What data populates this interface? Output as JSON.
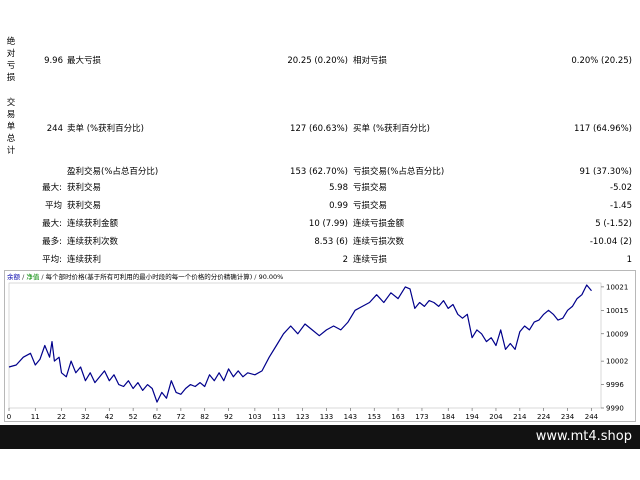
{
  "report": {
    "abs_dd": {
      "vlabel": "绝\n对\n亏\n损",
      "value": "9.96",
      "max_dd_label": "最大亏损",
      "max_dd_value": "20.25 (0.20%)",
      "rel_dd_label": "相对亏损",
      "rel_dd_value": "0.20% (20.25)"
    },
    "trades": {
      "vlabel": "交\n易\n单\n总\n计",
      "total": "244",
      "short_label": "卖单 (%获利百分比)",
      "short_value": "127 (60.63%)",
      "long_label": "买单 (%获利百分比)",
      "long_value": "117 (64.96%)"
    },
    "profit_trades_label": "盈利交易(%占总百分比)",
    "profit_trades_value": "153 (62.70%)",
    "loss_trades_label": "亏损交易(%占总百分比)",
    "loss_trades_value": "91 (37.30%)",
    "rows": [
      {
        "prefix": "最大:",
        "l_label": "获利交易",
        "l_value": "5.98",
        "r_label": "亏损交易",
        "r_value": "-5.02"
      },
      {
        "prefix": "平均",
        "l_label": "获利交易",
        "l_value": "0.99",
        "r_label": "亏损交易",
        "r_value": "-1.45"
      },
      {
        "prefix": "最大:",
        "l_label": "连续获利金额",
        "l_value": "10 (7.99)",
        "r_label": "连续亏损金额",
        "r_value": "5 (-1.52)"
      },
      {
        "prefix": "最多:",
        "l_label": "连续获利次数",
        "l_value": "8.53 (6)",
        "r_label": "连续亏损次数",
        "r_value": "-10.04 (2)"
      },
      {
        "prefix": "平均:",
        "l_label": "连续获利",
        "l_value": "2",
        "r_label": "连续亏损",
        "r_value": "1"
      }
    ]
  },
  "chart_header": {
    "balance": "余额",
    "equity": "净值",
    "sep": " / ",
    "description": "每个部时价格(基于所有可利用的最小时段的每一个价格的分价精确计算)",
    "quality": "90.00%"
  },
  "chart_data": {
    "type": "line",
    "x_ticks": [
      0,
      11,
      22,
      32,
      42,
      52,
      62,
      72,
      82,
      92,
      103,
      113,
      123,
      133,
      143,
      153,
      163,
      173,
      184,
      194,
      204,
      214,
      224,
      234,
      244
    ],
    "y_ticks": [
      9990,
      9996,
      10002,
      10009,
      10015,
      10021
    ],
    "ylim": [
      9990,
      10022
    ],
    "xlim": [
      0,
      248
    ],
    "series": [
      {
        "color": "#00008b",
        "x": [
          0,
          3,
          6,
          9,
          11,
          13,
          15,
          17,
          18,
          19,
          21,
          22,
          24,
          26,
          28,
          30,
          32,
          34,
          36,
          38,
          40,
          42,
          44,
          46,
          48,
          50,
          52,
          54,
          56,
          58,
          60,
          62,
          64,
          66,
          68,
          70,
          72,
          74,
          76,
          78,
          80,
          82,
          84,
          86,
          88,
          90,
          92,
          94,
          96,
          98,
          100,
          103,
          106,
          109,
          112,
          115,
          118,
          121,
          124,
          127,
          130,
          133,
          136,
          139,
          142,
          145,
          148,
          151,
          154,
          157,
          160,
          163,
          166,
          168,
          170,
          172,
          174,
          176,
          178,
          180,
          182,
          184,
          186,
          188,
          190,
          192,
          194,
          196,
          198,
          200,
          202,
          204,
          206,
          208,
          210,
          212,
          214,
          216,
          218,
          220,
          222,
          224,
          226,
          228,
          230,
          232,
          234,
          236,
          238,
          240,
          242,
          244
        ],
        "values": [
          10000.5,
          10001,
          10003,
          10004,
          10001,
          10002.5,
          10006,
          10003,
          10007,
          10002,
          10003,
          9999,
          9998,
          10002,
          9999,
          10000.5,
          9997,
          9999,
          9996.5,
          9998,
          9999.5,
          9997,
          9998.5,
          9996,
          9995.5,
          9997,
          9995,
          9996.5,
          9994.5,
          9996,
          9995,
          9991.5,
          9994,
          9992.5,
          9997,
          9994,
          9993.5,
          9995,
          9996,
          9995.5,
          9996.5,
          9995.5,
          9998.5,
          9997,
          9999,
          9997,
          10000,
          9998,
          9999.5,
          9998,
          9999,
          9998.5,
          9999.5,
          10003,
          10006,
          10009,
          10011,
          10009,
          10011.5,
          10010,
          10008.5,
          10010,
          10011,
          10010,
          10012,
          10015,
          10016,
          10017,
          10019,
          10017,
          10019.5,
          10018,
          10021,
          10020.5,
          10015.5,
          10017,
          10016,
          10017.5,
          10017,
          10016,
          10017.5,
          10015.5,
          10016.5,
          10014,
          10013,
          10014,
          10008,
          10010,
          10009,
          10007,
          10008,
          10006,
          10010,
          10005,
          10006.5,
          10005,
          10009.5,
          10011,
          10010,
          10012,
          10012.5,
          10014,
          10015,
          10014,
          10012.5,
          10013,
          10015,
          10016,
          10018,
          10019,
          10021.5,
          10020
        ]
      }
    ]
  },
  "footer": {
    "site": "www.mt4.shop"
  },
  "colors": {
    "line": "#00008b",
    "footer_bg": "#121212",
    "footer_text": "#ffffff"
  }
}
